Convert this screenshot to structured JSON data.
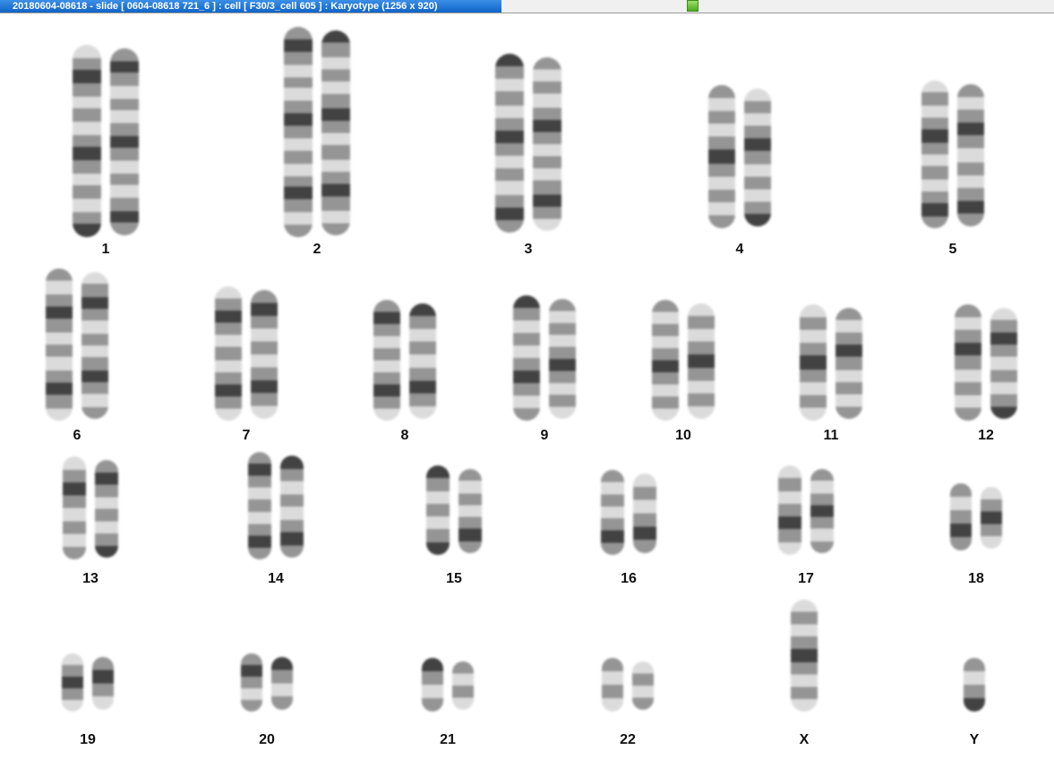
{
  "window": {
    "title": "20180604-08618 - slide [ 0604-08618 721_6 ] : cell [ F30/3_cell 605 ] : Karyotype  (1256 x 920)"
  },
  "status_indicator_color": "#5cc22a",
  "chromosome_labels": [
    "1",
    "2",
    "3",
    "4",
    "5",
    "6",
    "7",
    "8",
    "9",
    "10",
    "11",
    "12",
    "13",
    "14",
    "15",
    "16",
    "17",
    "18",
    "19",
    "20",
    "21",
    "22",
    "X",
    "Y"
  ],
  "band_colors": {
    "light": "#d8d8d8",
    "mid": "#8a8a8a",
    "dark": "#2e2e2e"
  }
}
